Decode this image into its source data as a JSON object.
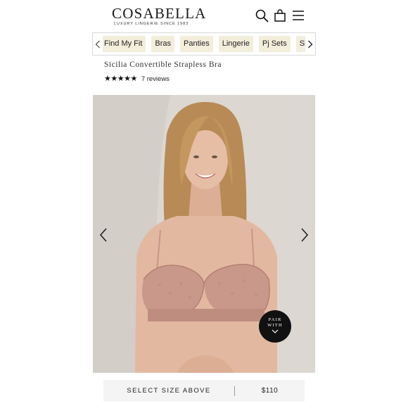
{
  "header": {
    "logo_main": "COSABELLA",
    "logo_sub": "LUXURY LINGERIE SINCE 1983",
    "icons": [
      "search-icon",
      "shopping-bag-icon",
      "hamburger-menu-icon"
    ]
  },
  "categories": {
    "items": [
      {
        "label": "Find My Fit"
      },
      {
        "label": "Bras"
      },
      {
        "label": "Panties"
      },
      {
        "label": "Lingerie"
      },
      {
        "label": "Pj Sets"
      },
      {
        "label": "Sleepw"
      }
    ],
    "icons": [
      "chevron-left-icon",
      "chevron-right-icon"
    ]
  },
  "product": {
    "title": "Sicilia Convertible Strapless Bra",
    "stars": "★★★★★",
    "rating": 5,
    "reviews": "7 reviews"
  },
  "gallery": {
    "icons": [
      "chevron-left-icon",
      "chevron-right-icon"
    ],
    "pair_with": "PAIR\nWITH",
    "colors": {
      "background": "#dcd7d1",
      "skin": "#e2b9a0",
      "lace": "#c9988a",
      "hair": "#b88a55"
    }
  },
  "buybar": {
    "select_label": "SELECT SIZE ABOVE",
    "price": "$110"
  }
}
